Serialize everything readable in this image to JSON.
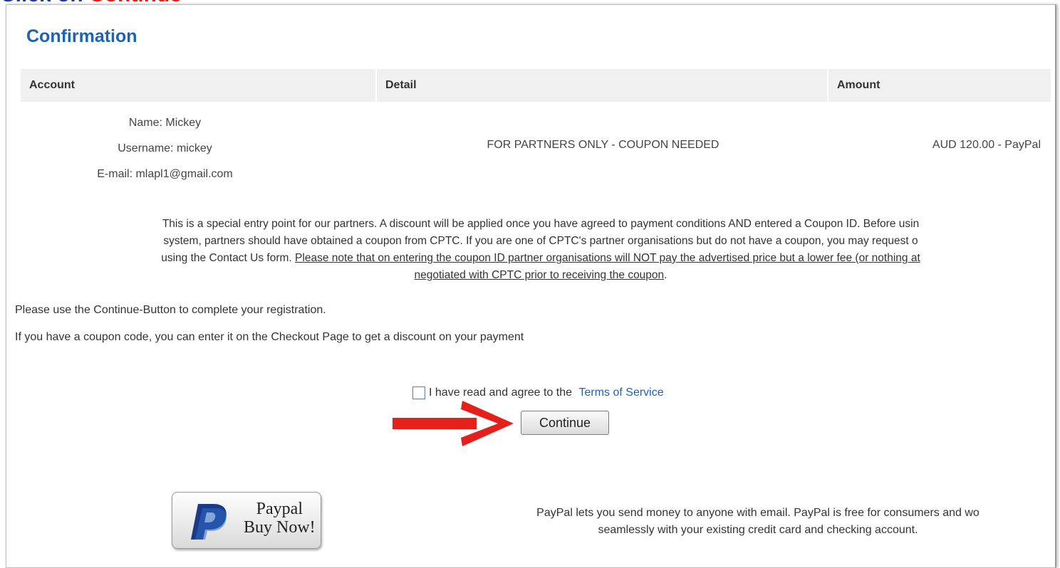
{
  "banner": {
    "part1": "Click on ",
    "part2": "Continue"
  },
  "page_title": "Confirmation",
  "table": {
    "headers": [
      "Account",
      "Detail",
      "Amount"
    ],
    "account": {
      "name": "Name: Mickey",
      "username": "Username: mickey",
      "email": "E-mail: mlapl1@gmail.com"
    },
    "detail": "FOR PARTNERS ONLY - COUPON NEEDED",
    "amount": "AUD 120.00 -  PayPal"
  },
  "notice": {
    "line1": "This is a special entry point for our partners. A discount will be applied once you have agreed to payment conditions AND entered a Coupon ID. Before usin",
    "line2": "system, partners should have obtained a coupon from CPTC. If  you are one of CPTC's partner organisations but do not have a coupon, you may request o",
    "line3_plain": "using the Contact Us form. ",
    "line3_underlined": "Please note that on entering the coupon ID partner organisations will NOT pay the advertised price but a lower fee (or nothing at",
    "line4_underlined": "negotiated with CPTC prior to receiving the coupon",
    "line4_tail": "."
  },
  "instructions": {
    "line1": "Please use the Continue-Button to complete your registration.",
    "line2": "If you have a coupon code, you can enter it on the Checkout Page to get a discount on your payment"
  },
  "agree": {
    "label": "I have read and agree to the ",
    "link": "Terms of Service",
    "checked": false
  },
  "continue_label": "Continue",
  "paypal": {
    "button_line1": "Paypal",
    "button_line2": "Buy Now!",
    "info_line1": "PayPal lets you send money to anyone with email. PayPal is free for consumers and wo",
    "info_line2": "seamlessly with your existing credit card and checking account."
  },
  "colors": {
    "title": "#1c63b7",
    "banner_blue": "#1f3f99",
    "banner_red": "#e4201b",
    "arrow": "#e4201b",
    "link": "#1c63b7"
  },
  "icons": {
    "arrow": "red-arrow-icon",
    "paypal": "paypal-logo-icon"
  }
}
